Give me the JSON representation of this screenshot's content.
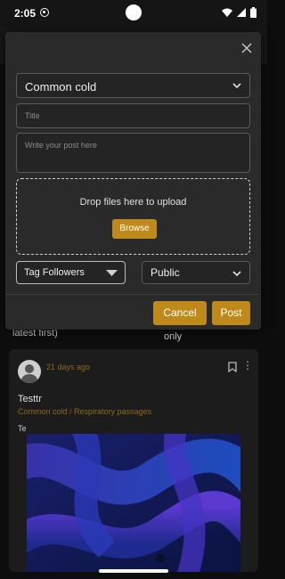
{
  "status_bar": {
    "time": "2:05",
    "icons": [
      "app-notification-icon",
      "wifi-icon",
      "signal-icon",
      "battery-icon"
    ]
  },
  "background": {
    "sort_fragment": "latest first)",
    "visibility_fragment": "only"
  },
  "post": {
    "time_ago": "21 days ago",
    "title": "Testtr",
    "category_path": "Common cold / Respiratory passages",
    "body": "Te"
  },
  "modal": {
    "category_value": "Common cold",
    "title_placeholder": "Title",
    "post_placeholder": "Write your post here",
    "dropzone_text": "Drop files here to upload",
    "browse_label": "Browse",
    "tag_select_value": "Tag Followers",
    "visibility_value": "Public",
    "cancel_label": "Cancel",
    "post_label": "Post"
  },
  "colors": {
    "accent": "#c08a1b",
    "muted_accent_text": "#8c6a1f",
    "modal_bg": "#2a2a2a",
    "page_bg": "#0d0d0d"
  }
}
